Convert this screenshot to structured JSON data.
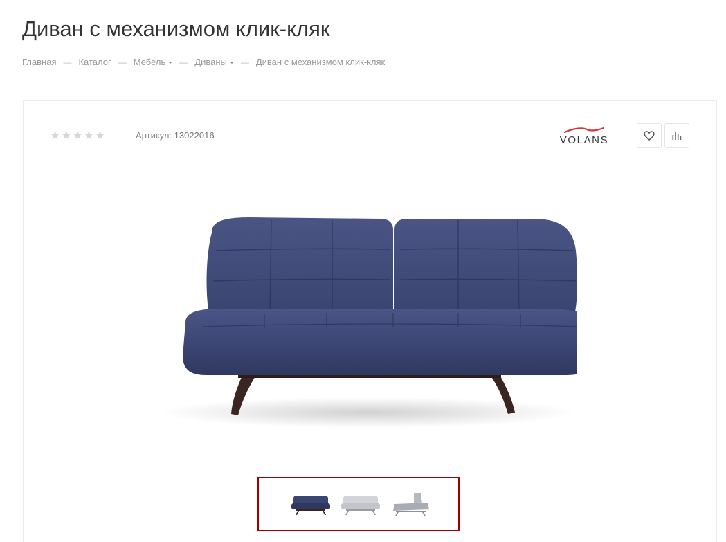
{
  "page": {
    "title": "Диван с механизмом клик-кляк"
  },
  "breadcrumb": {
    "items": [
      {
        "label": "Главная",
        "dropdown": false
      },
      {
        "label": "Каталог",
        "dropdown": false
      },
      {
        "label": "Мебель",
        "dropdown": true
      },
      {
        "label": "Диваны",
        "dropdown": true
      },
      {
        "label": "Диван с механизмом клик-кляк",
        "dropdown": false
      }
    ],
    "separator": "—"
  },
  "product": {
    "rating": {
      "stars_total": 5,
      "stars_filled": 0,
      "star_glyph": "★"
    },
    "sku_label": "Артикул:",
    "sku_value": "13022016",
    "brand": "VOLANS",
    "brand_accent_color": "#d9353a",
    "wishlist_icon": "heart-icon",
    "compare_icon": "bar-chart-icon",
    "main_image": "sofa-navy-blue",
    "thumbnails": [
      {
        "image": "sofa-navy-blue",
        "color": "#3b4670"
      },
      {
        "image": "sofa-light-gray",
        "color": "#c9cbd0"
      },
      {
        "image": "sofa-gray-reclined",
        "color": "#b6b9c0"
      }
    ],
    "thumbnail_active_border": "#a40000"
  }
}
